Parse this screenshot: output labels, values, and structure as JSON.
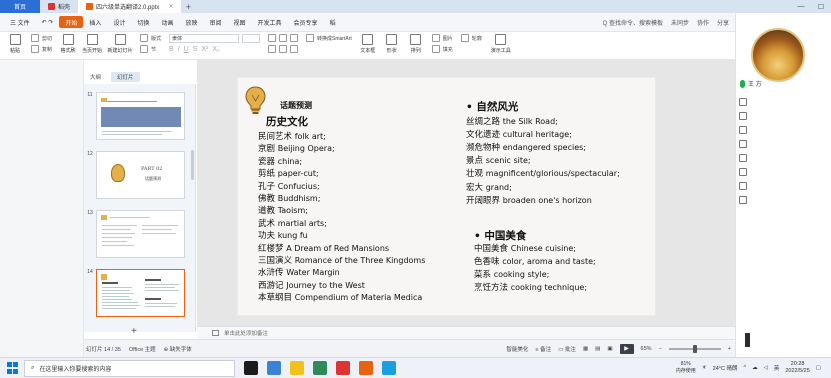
{
  "tabs": {
    "home": "首页",
    "tab1": "稻壳",
    "tab2": "四六级单选翻译2.0.pptx"
  },
  "menu": {
    "items": [
      "三 文件",
      "开始",
      "插入",
      "设计",
      "切换",
      "动画",
      "放映",
      "审阅",
      "视图",
      "开发工具",
      "会员专享",
      "稻"
    ],
    "active": "开始",
    "file_label": "三 文件",
    "search": "Q 查找命令、搜索模板",
    "unsync": "未同步",
    "collab": "协作",
    "share": "分享"
  },
  "toolbar": {
    "paste": "粘贴",
    "cut": "剪切",
    "copy": "复制",
    "format_painter": "格式刷",
    "play_from_current": "当页开始",
    "new_slide": "新建幻灯片",
    "layout": "版式",
    "section": "节",
    "reset": "重置",
    "font_value": "隶体",
    "textbox": "文本框",
    "shape": "形状",
    "arrange": "排列",
    "sort": "排列",
    "picture": "图片",
    "fill": "填充",
    "outline": "轮廓",
    "presentation_tool": "演示工具",
    "convert_smartart": "转换成SmartArt"
  },
  "view_tabs": [
    "大纲",
    "幻灯片"
  ],
  "slides": [
    {
      "num": "11"
    },
    {
      "num": "12",
      "part": "PART 02",
      "sub": "话题预测"
    },
    {
      "num": "13"
    },
    {
      "num": "14"
    }
  ],
  "slide_content": {
    "topic_label": "话题预测",
    "history": {
      "heading": "历史文化",
      "items": [
        {
          "zh": "民间艺术",
          "en": "folk art;"
        },
        {
          "zh": "京剧",
          "en": "Beijing Opera;"
        },
        {
          "zh": "瓷器",
          "en": "china;"
        },
        {
          "zh": "剪纸",
          "en": "paper-cut;"
        },
        {
          "zh": "孔子",
          "en": "Confucius;"
        },
        {
          "zh": "佛教",
          "en": "Buddhism;"
        },
        {
          "zh": "道教",
          "en": "Taoism;"
        },
        {
          "zh": "武术",
          "en": "martial arts;"
        },
        {
          "zh": "功夫",
          "en": "kung fu"
        },
        {
          "zh": "红楼梦",
          "en": "A Dream of Red Mansions"
        },
        {
          "zh": "三国演义",
          "en": "Romance of the Three Kingdoms"
        },
        {
          "zh": "水浒传",
          "en": "Water Margin"
        },
        {
          "zh": "西游记",
          "en": "Journey to the West"
        },
        {
          "zh": "本草纲目",
          "en": "Compendium of Materia Medica"
        }
      ]
    },
    "nature": {
      "heading": "自然风光",
      "items": [
        {
          "zh": "丝绸之路",
          "en": "the Silk Road;"
        },
        {
          "zh": "文化遗迹",
          "en": "cultural heritage;"
        },
        {
          "zh": "濒危物种",
          "en": "endangered species;"
        },
        {
          "zh": "景点",
          "en": "scenic site;"
        },
        {
          "zh": "壮观",
          "en": "magnificent/glorious/spectacular;"
        },
        {
          "zh": "宏大",
          "en": "grand;"
        },
        {
          "zh": "开阔眼界",
          "en": "broaden one's horizon"
        }
      ]
    },
    "food": {
      "heading": "中国美食",
      "items": [
        {
          "zh": "中国美食",
          "en": "Chinese cuisine;"
        },
        {
          "zh": "色香味",
          "en": "color, aroma and taste;"
        },
        {
          "zh": "菜系",
          "en": "cooking style;"
        },
        {
          "zh": "烹饪方法",
          "en": "cooking technique;"
        }
      ]
    }
  },
  "notes_placeholder": "单击此处添加备注",
  "status": {
    "slide_counter": "幻灯片 14 / 35",
    "theme": "Office 主题",
    "missing_font": "缺失字体",
    "smart_beautify": "智能美化",
    "notes": "备注",
    "comments": "批注",
    "zoom": "65%"
  },
  "presenter": {
    "name": "王 方"
  },
  "taskbar": {
    "search_placeholder": "在这里输入你要搜索的内容",
    "cpu_value": "81%",
    "cpu_label": "内存使用",
    "weather": "24°C 晴朗",
    "ime": "英",
    "time": "20:28",
    "date": "2022/5/25"
  }
}
